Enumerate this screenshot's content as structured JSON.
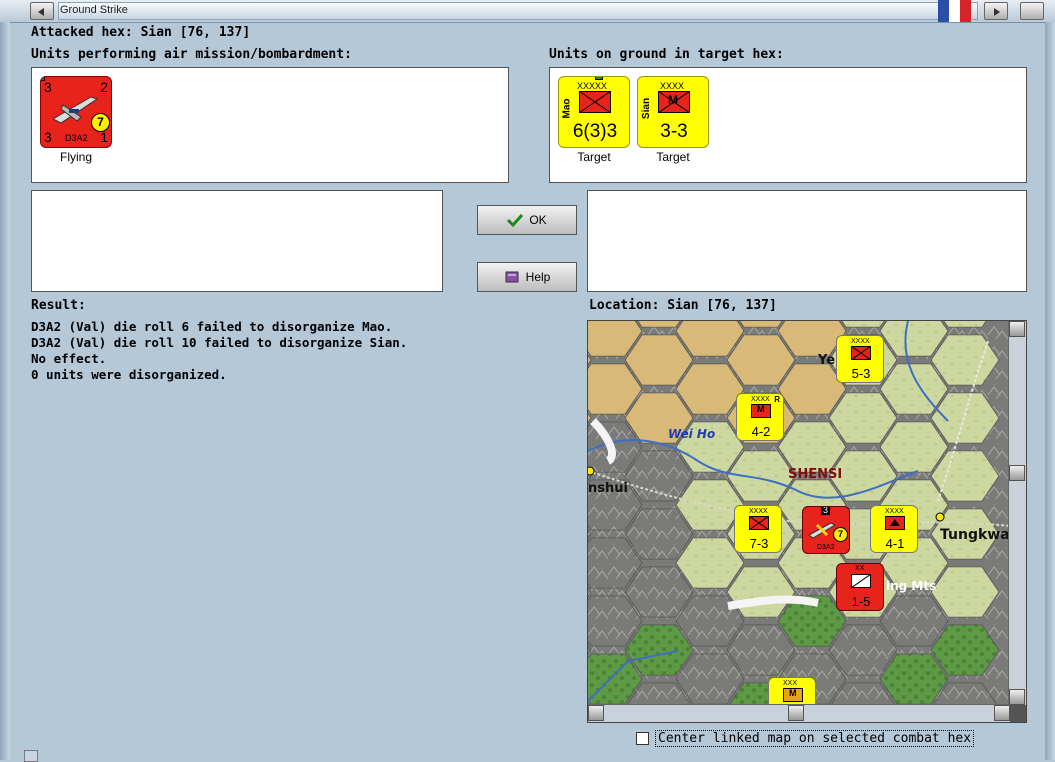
{
  "window": {
    "title": "Ground Strike"
  },
  "header": {
    "attacked_hex": "Attacked hex: Sian  [76, 137]"
  },
  "air_panel": {
    "label": "Units performing air mission/bombardment:",
    "units": [
      {
        "name": "D3A2",
        "top_left": "3",
        "top_right": "2",
        "bottom_left": "3",
        "bottom_right": "1",
        "badge": "7",
        "caption": "Flying",
        "color": "#e8231c"
      }
    ]
  },
  "ground_panel": {
    "label": "Units on ground in target hex:",
    "units": [
      {
        "name": "Mao",
        "size": "XXXXX",
        "strength": "6(3)3",
        "caption": "Target",
        "color": "#ffff00"
      },
      {
        "name": "Sian",
        "size": "XXXX",
        "strength": "3-3",
        "type_letter": "M",
        "caption": "Target",
        "color": "#ffff00"
      }
    ]
  },
  "buttons": {
    "ok_label": "OK",
    "help_label": "Help"
  },
  "result": {
    "label": "Result:",
    "lines": [
      "D3A2 (Val) die roll 6 failed to disorganize Mao.",
      "D3A2 (Val) die roll 10 failed to disorganize Sian.",
      "No effect.",
      "0 units were disorganized."
    ]
  },
  "location": {
    "label": "Location:  Sian  [76, 137]"
  },
  "map": {
    "labels": {
      "region": "SHENSI",
      "river": "Wei Ho",
      "city_1": "Tungkwa",
      "city_2": "Ye",
      "city_3": "nshui",
      "mts": "ing Mts"
    },
    "counters": [
      {
        "id": "c1",
        "strength": "5-3",
        "size": "XXXX",
        "color": "#ffff00"
      },
      {
        "id": "c2",
        "strength": "4-2",
        "size": "XXXX",
        "type_letter": "M",
        "extra": "R",
        "color": "#ffff00"
      },
      {
        "id": "c3",
        "strength": "7-3",
        "size": "XXXX",
        "color": "#ffff00"
      },
      {
        "id": "c4",
        "name": "D3A2",
        "badge": "7",
        "stack": "3",
        "color": "#e8231c"
      },
      {
        "id": "c5",
        "strength": "4-1",
        "size": "XXXX",
        "color": "#ffff00"
      },
      {
        "id": "c6",
        "strength": "1-5",
        "size": "XX",
        "color": "#e8231c"
      },
      {
        "id": "c7",
        "size": "XXX",
        "type_letter": "M",
        "color": "#ffff00"
      }
    ]
  },
  "option": {
    "center_linked_map": "Center linked map on selected combat hex"
  },
  "colors": {
    "background": "#b5c8d8",
    "axis_red": "#e8231c",
    "china_yellow": "#ffff00"
  }
}
